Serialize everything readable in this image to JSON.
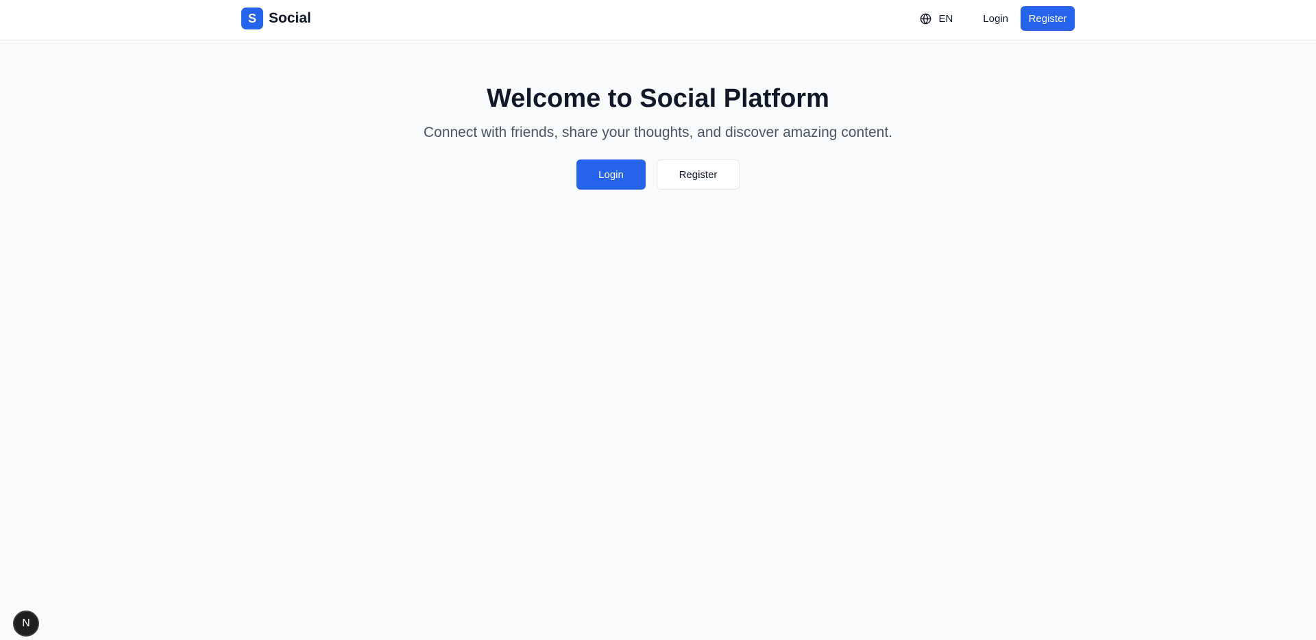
{
  "header": {
    "brand_letter": "S",
    "brand_name": "Social",
    "language_label": "EN",
    "login_label": "Login",
    "register_label": "Register"
  },
  "hero": {
    "title": "Welcome to Social Platform",
    "subtitle": "Connect with friends, share your thoughts, and discover amazing content.",
    "login_label": "Login",
    "register_label": "Register"
  },
  "dev_badge": {
    "letter": "N"
  },
  "icons": {
    "language": "globe-icon",
    "dev_badge": "nextjs-logo-icon"
  },
  "colors": {
    "primary": "#2563eb",
    "background": "#f8fafc",
    "header_background": "#ffffff",
    "title_text": "#111827",
    "subtitle_text": "#4b5563"
  }
}
